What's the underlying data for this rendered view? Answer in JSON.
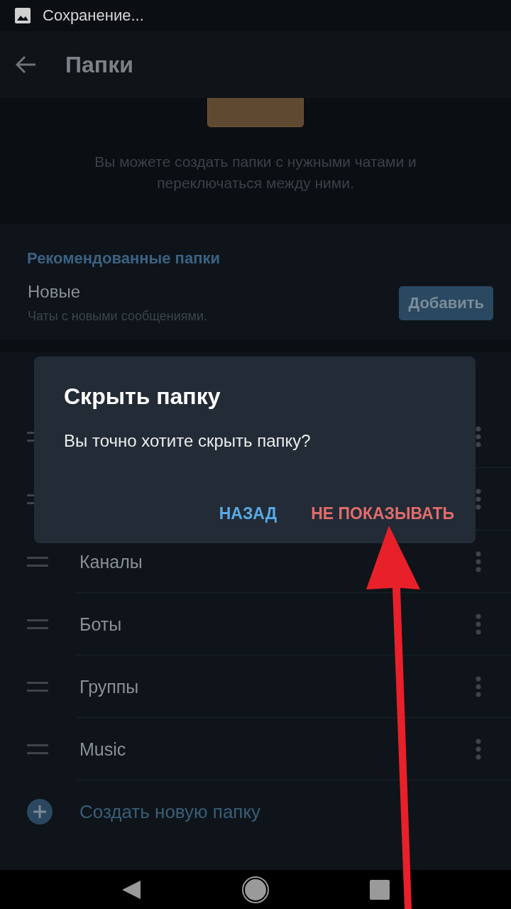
{
  "status_bar": {
    "notification": "Сохранение..."
  },
  "app_bar": {
    "title": "Папки"
  },
  "intro": {
    "text": "Вы можете создать папки с нужными чатами и переключаться между ними."
  },
  "recommended": {
    "header": "Рекомендованные папки",
    "items": [
      {
        "name": "Новые",
        "description": "Чаты с новыми сообщениями.",
        "button": "Добавить"
      }
    ]
  },
  "folders": {
    "items": [
      {
        "kind": "hidden"
      },
      {
        "kind": "hidden"
      },
      {
        "kind": "folder",
        "name": "Каналы"
      },
      {
        "kind": "folder",
        "name": "Боты"
      },
      {
        "kind": "folder",
        "name": "Группы"
      },
      {
        "kind": "folder",
        "name": "Music"
      }
    ],
    "create": "Создать новую папку"
  },
  "dialog": {
    "title": "Скрыть папку",
    "message": "Вы точно хотите скрыть папку?",
    "buttons": [
      {
        "label": "НАЗАД",
        "kind": "cancel"
      },
      {
        "label": "НЕ ПОКАЗЫВАТЬ",
        "kind": "destructive"
      }
    ]
  }
}
